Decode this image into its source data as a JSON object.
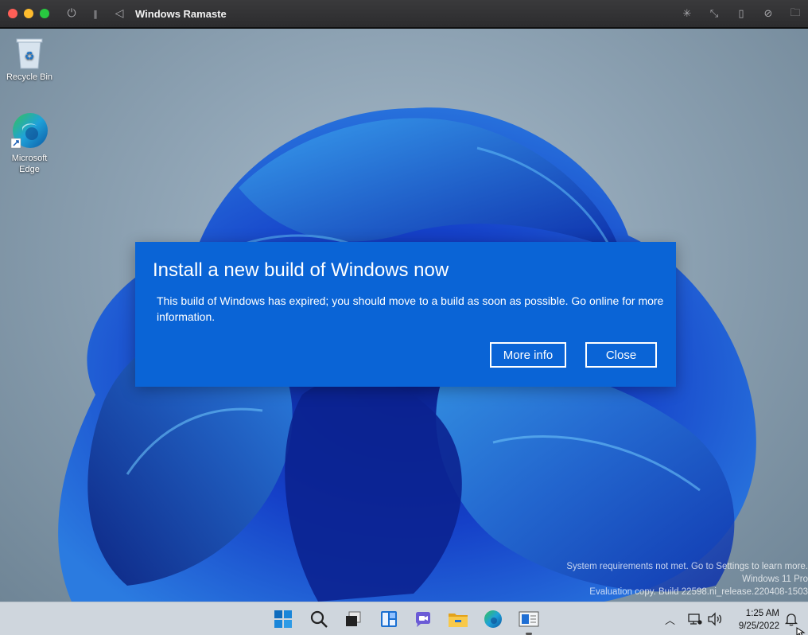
{
  "host_window": {
    "title": "Windows Ramaste",
    "left_icons": [
      "power-icon",
      "pause-icon",
      "back-icon"
    ],
    "right_icons": [
      "loading-icon",
      "resize-icon",
      "usb-icon",
      "network-icon",
      "folder-icon"
    ]
  },
  "desktop": {
    "icons": [
      {
        "label": "Recycle Bin",
        "icon": "recycle-bin-icon"
      },
      {
        "label": "Microsoft Edge",
        "icon": "edge-icon"
      }
    ],
    "watermark": {
      "line1": "System requirements not met. Go to Settings to learn more.",
      "line2": "Windows 11 Pro",
      "line3": "Evaluation copy. Build 22598.ni_release.220408-1503"
    }
  },
  "dialog": {
    "title": "Install a new build of Windows now",
    "body": "This build of Windows has expired; you should move to a build as soon as possible. Go online for more information.",
    "more_info_label": "More info",
    "close_label": "Close"
  },
  "taskbar": {
    "apps": [
      "start-icon",
      "search-icon",
      "task-view-icon",
      "widgets-icon",
      "chat-icon",
      "file-explorer-icon",
      "edge-icon",
      "app-icon"
    ],
    "tray_icons": [
      "chevron-up-icon",
      "network-icon",
      "volume-icon",
      "notification-icon"
    ],
    "time": "1:25 AM",
    "date": "9/25/2022"
  },
  "colors": {
    "dialog_bg": "#0a64d6",
    "taskbar_bg": "#cfd6dd",
    "accent": "#0067c0"
  }
}
